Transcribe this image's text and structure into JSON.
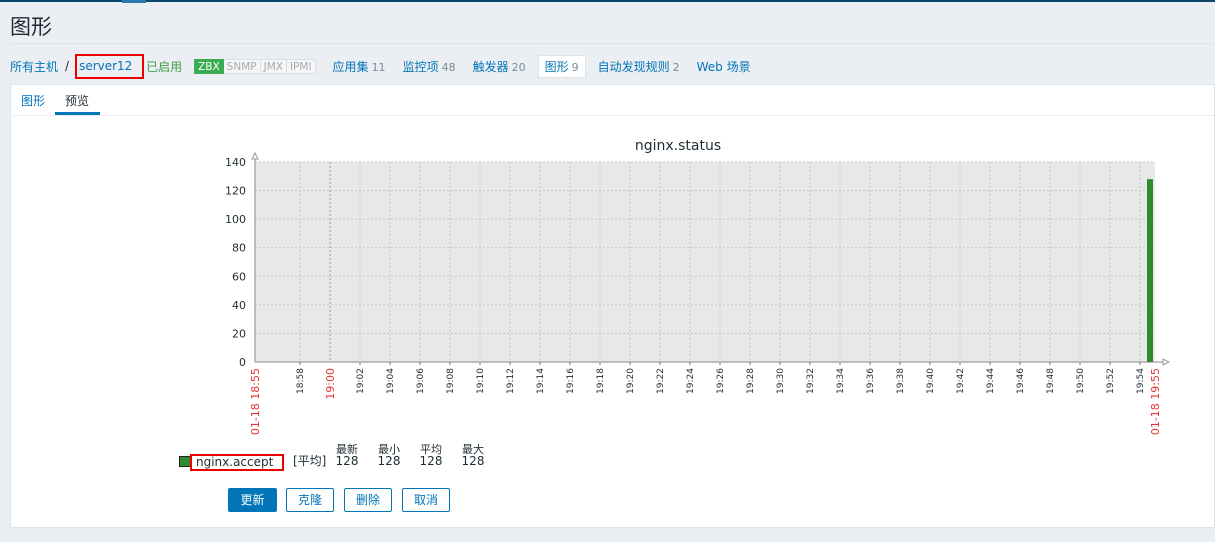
{
  "page_title": "图形",
  "breadcrumb": {
    "all_hosts": "所有主机",
    "separator": "/",
    "host": "server12",
    "status": "已启用"
  },
  "protocols": [
    {
      "label": "ZBX",
      "active": true
    },
    {
      "label": "SNMP",
      "active": false
    },
    {
      "label": "JMX",
      "active": false
    },
    {
      "label": "IPMI",
      "active": false
    }
  ],
  "host_nav": [
    {
      "label": "应用集",
      "count": "11"
    },
    {
      "label": "监控项",
      "count": "48"
    },
    {
      "label": "触发器",
      "count": "20"
    },
    {
      "label": "图形",
      "count": "9"
    },
    {
      "label": "自动发现规则",
      "count": "2"
    },
    {
      "label": "Web 场景",
      "count": ""
    }
  ],
  "tabs": {
    "graph": "图形",
    "preview": "预览"
  },
  "legend": {
    "item": "nginx.accept",
    "func": "[平均]",
    "headers": [
      "最新",
      "最小",
      "平均",
      "最大"
    ],
    "values": [
      "128",
      "128",
      "128",
      "128"
    ]
  },
  "buttons": {
    "update": "更新",
    "clone": "克隆",
    "delete": "删除",
    "cancel": "取消"
  },
  "chart_data": {
    "type": "bar",
    "title": "nginx.status",
    "ylim": [
      0,
      140
    ],
    "yticks": [
      "0",
      "20",
      "40",
      "60",
      "80",
      "100",
      "120",
      "140"
    ],
    "x_start_label": "01-18 18:55",
    "x_end_label": "01-18 19:55",
    "x_hour_label": "19:00",
    "x_ticks": [
      "18:58",
      "19:02",
      "19:04",
      "19:06",
      "19:08",
      "19:10",
      "19:12",
      "19:14",
      "19:16",
      "19:18",
      "19:20",
      "19:22",
      "19:24",
      "19:26",
      "19:28",
      "19:30",
      "19:32",
      "19:34",
      "19:36",
      "19:38",
      "19:40",
      "19:42",
      "19:44",
      "19:46",
      "19:48",
      "19:50",
      "19:52",
      "19:54"
    ],
    "series": [
      {
        "name": "nginx.accept",
        "x": [
          "19:55"
        ],
        "values": [
          128
        ]
      }
    ],
    "grid": true,
    "colors": {
      "series": "#2e8b2e",
      "plot_bg": "#e8e8e8",
      "grid": "#c8c8c8",
      "red_label": "#e63333"
    }
  }
}
